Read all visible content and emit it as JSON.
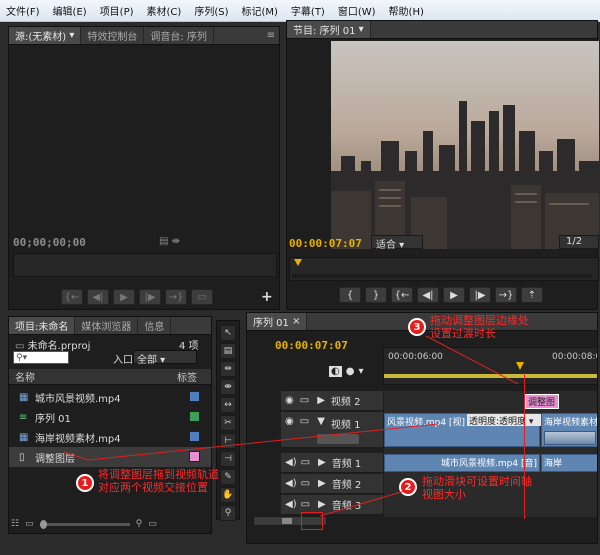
{
  "menu": [
    "文件(F)",
    "编辑(E)",
    "项目(P)",
    "素材(C)",
    "序列(S)",
    "标记(M)",
    "字幕(T)",
    "窗口(W)",
    "帮助(H)"
  ],
  "source_panel": {
    "tabs": [
      "源:(无素材)",
      "特效控制台",
      "调音台: 序列"
    ],
    "timecode": "00;00;00;00"
  },
  "program_panel": {
    "tab": "节目: 序列 01",
    "timecode": "00:00:07:07",
    "fit": "适合",
    "scale": "1/2"
  },
  "project_panel": {
    "tabs": [
      "项目:未命名",
      "媒体浏览器",
      "信息"
    ],
    "project_file": "未命名.prproj",
    "item_count": "4 项",
    "entry_label": "入口:",
    "entry_value": "全部",
    "col_name": "名称",
    "col_label": "标签",
    "items": [
      {
        "name": "城市风景视频.mp4",
        "icon": "video-clip-icon",
        "color": "#4f7fc0"
      },
      {
        "name": "序列 01",
        "icon": "sequence-icon",
        "color": "#3f9e5a"
      },
      {
        "name": "海岸视频素材.mp4",
        "icon": "video-clip-icon",
        "color": "#4f7fc0"
      },
      {
        "name": "调整图层",
        "icon": "adjustment-layer-icon",
        "color": "#e88fd2"
      }
    ]
  },
  "timeline": {
    "tab": "序列 01",
    "timecode": "00:00:07:07",
    "ruler_labels": [
      "00:00:06:00",
      "00:00:08:00"
    ],
    "tracks": [
      {
        "name": "视频 2"
      },
      {
        "name": "视频 1"
      },
      {
        "name": "音频 1"
      },
      {
        "name": "音频 2"
      },
      {
        "name": "音频 3"
      }
    ],
    "clips": {
      "adjustment": "调整图",
      "video1_a": "风景视频.mp4 [视]",
      "video1_b": "透明度:透明度",
      "video1_c": "海岸视频素材",
      "audio1_a": "城市风景视频.mp4 [音]",
      "audio1_b": "海岸"
    }
  },
  "annotations": [
    {
      "num": "1",
      "lines": [
        "将调整图层拖到视频轨道",
        "对应两个视频交接位置"
      ]
    },
    {
      "num": "2",
      "lines": [
        "拖动滑块可设置时间轴",
        "视图大小"
      ]
    },
    {
      "num": "3",
      "lines": [
        "拖动调整图层边缘处",
        "设置过渡时长"
      ]
    }
  ],
  "colors": {
    "annotation": "#ff2a2a",
    "timecode": "#e8b000",
    "clip": "#5f86b3",
    "adjustment": "#e88fd2"
  }
}
